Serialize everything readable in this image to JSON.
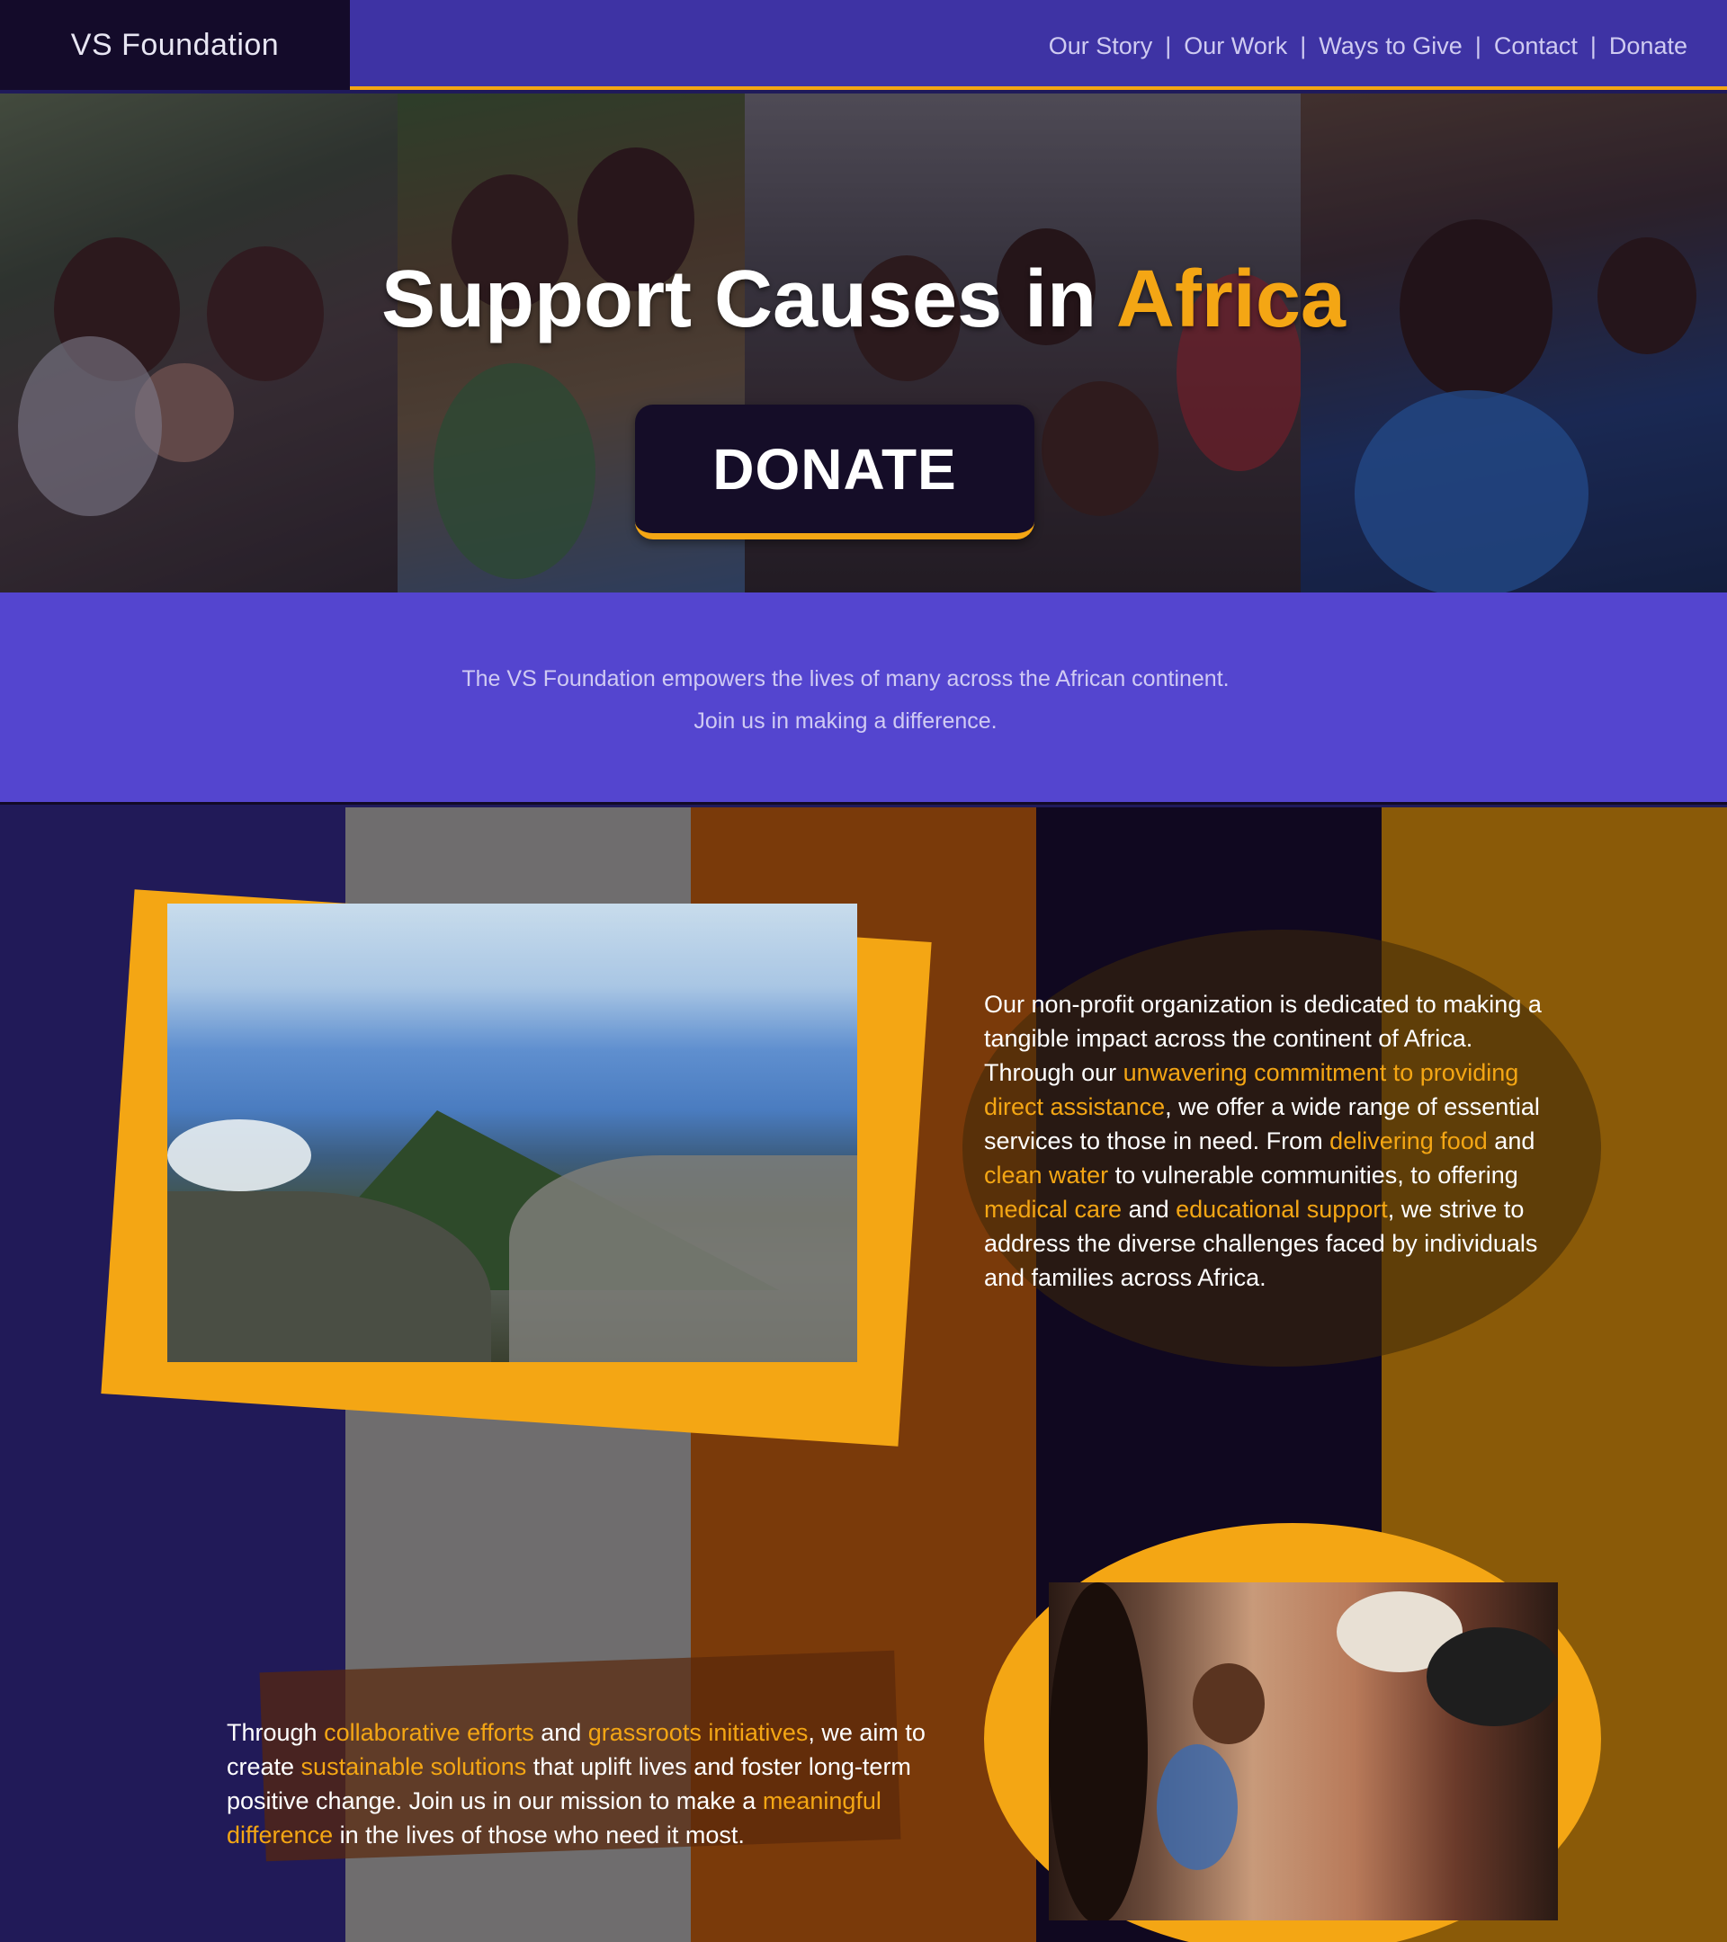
{
  "header": {
    "logo": "VS Foundation",
    "nav": [
      {
        "label": "Our Story"
      },
      {
        "label": "Our Work"
      },
      {
        "label": "Ways to Give"
      },
      {
        "label": "Contact"
      },
      {
        "label": "Donate"
      }
    ]
  },
  "hero": {
    "title_main": "Support Causes in ",
    "title_accent": "Africa",
    "donate_label": "DONATE"
  },
  "intro": {
    "line1": "The VS Foundation empowers the lives of many across the African continent.",
    "line2": "Join us in making a difference."
  },
  "section1": {
    "t1": "Our non-profit organization is dedicated to making a tangible impact across the continent of Africa. Through our ",
    "h1": "unwavering commitment to providing direct assistance",
    "t2": ", we offer a wide range of essential services to those in need. From ",
    "h2": "delivering food",
    "t3": " and ",
    "h3": "clean water",
    "t4": " to vulnerable communities, to offering ",
    "h4": "medical care",
    "t5": " and ",
    "h5": "educational support",
    "t6": ", we strive to address the diverse challenges faced by individuals and families across Africa."
  },
  "section2": {
    "t1": "Through ",
    "h1": "collaborative efforts",
    "t2": " and ",
    "h2": "grassroots initiatives",
    "t3": ", we aim to create ",
    "h3": "sustainable solutions",
    "t4": " that uplift lives and foster long-term positive change. Join us in our mission to make a ",
    "h4": "meaningful difference",
    "t5": " in the lives of those who need it most."
  },
  "colors": {
    "accent": "#f4a614",
    "header_bg": "#3e33a4",
    "intro_bg": "#5445cf",
    "dark": "#140b2a"
  }
}
